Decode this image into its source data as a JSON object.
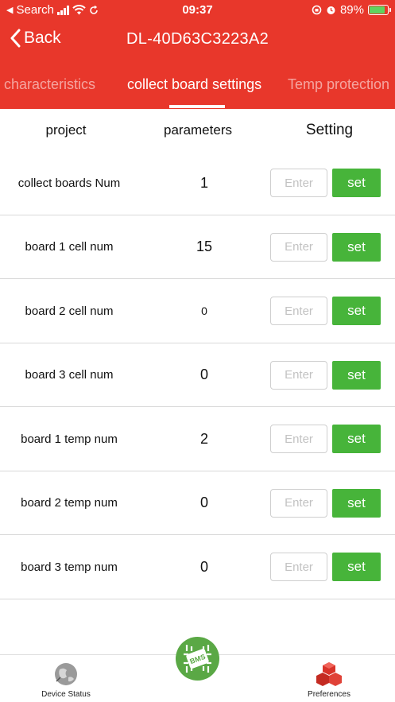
{
  "status_bar": {
    "back_app": "Search",
    "time": "09:37",
    "battery": "89%"
  },
  "nav": {
    "back_label": "Back",
    "title": "DL-40D63C3223A2"
  },
  "tabs": [
    {
      "label": "ll characteristics"
    },
    {
      "label": "collect board settings"
    },
    {
      "label": "Temp protection"
    }
  ],
  "table": {
    "headers": {
      "project": "project",
      "parameters": "parameters",
      "setting": "Setting"
    },
    "placeholder": "Enter",
    "button": "set",
    "rows": [
      {
        "name": "collect boards Num",
        "value": "1"
      },
      {
        "name": "board 1 cell num",
        "value": "15"
      },
      {
        "name": "board 2 cell num",
        "value": "0"
      },
      {
        "name": "board 3 cell num",
        "value": "0"
      },
      {
        "name": "board 1 temp num",
        "value": "2"
      },
      {
        "name": "board 2 temp num",
        "value": "0"
      },
      {
        "name": "board 3 temp num",
        "value": "0"
      }
    ]
  },
  "tabbar": {
    "left": "Device Status",
    "center_logo": "BMS",
    "right": "Preferences"
  },
  "colors": {
    "header": "#e8372b",
    "set_button": "#47b43a",
    "bms_logo": "#5aa845"
  }
}
